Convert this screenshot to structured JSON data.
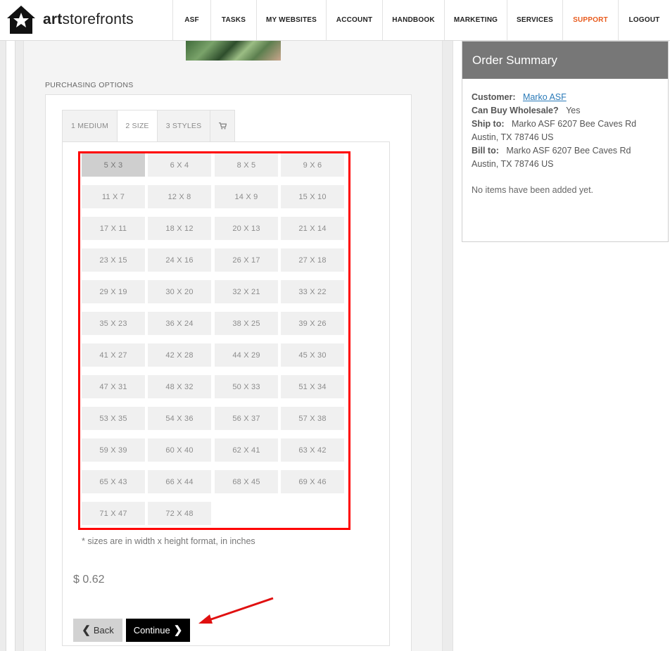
{
  "brand": {
    "name_bold": "art",
    "name_rest": "storefronts"
  },
  "nav": [
    {
      "label": "ASF",
      "width": 54
    },
    {
      "label": "TASKS",
      "width": 65
    },
    {
      "label": "MY WEBSITES",
      "width": 99
    },
    {
      "label": "ACCOUNT",
      "width": 80
    },
    {
      "label": "HANDBOOK",
      "width": 88
    },
    {
      "label": "MARKETING",
      "width": 89
    },
    {
      "label": "SERVICES",
      "width": 79
    },
    {
      "label": "SUPPORT",
      "width": 79,
      "active": true
    },
    {
      "label": "LOGOUT",
      "width": 74
    }
  ],
  "purchasing": {
    "section_label": "PURCHASING OPTIONS",
    "tabs": [
      {
        "label": "1 MEDIUM"
      },
      {
        "label": "2 SIZE",
        "active": true
      },
      {
        "label": "3 STYLES"
      },
      {
        "icon": "cart-icon"
      }
    ],
    "sizes": [
      "5 X 3",
      "6 X 4",
      "8 X 5",
      "9 X 6",
      "11 X 7",
      "12 X 8",
      "14 X 9",
      "15 X 10",
      "17 X 11",
      "18 X 12",
      "20 X 13",
      "21 X 14",
      "23 X 15",
      "24 X 16",
      "26 X 17",
      "27 X 18",
      "29 X 19",
      "30 X 20",
      "32 X 21",
      "33 X 22",
      "35 X 23",
      "36 X 24",
      "38 X 25",
      "39 X 26",
      "41 X 27",
      "42 X 28",
      "44 X 29",
      "45 X 30",
      "47 X 31",
      "48 X 32",
      "50 X 33",
      "51 X 34",
      "53 X 35",
      "54 X 36",
      "56 X 37",
      "57 X 38",
      "59 X 39",
      "60 X 40",
      "62 X 41",
      "63 X 42",
      "65 X 43",
      "66 X 44",
      "68 X 45",
      "69 X 46",
      "71 X 47",
      "72 X 48"
    ],
    "selected_size": "5 X 3",
    "note": "* sizes are in width x height format, in inches",
    "price": "$ 0.62",
    "back_label": "Back",
    "continue_label": "Continue"
  },
  "summary": {
    "title": "Order Summary",
    "customer_label": "Customer:",
    "customer_value": "Marko ASF",
    "wholesale_label": "Can Buy Wholesale?",
    "wholesale_value": "Yes",
    "ship_label": "Ship to:",
    "ship_value": "Marko ASF 6207 Bee Caves Rd Austin, TX 78746 US",
    "bill_label": "Bill to:",
    "bill_value": "Marko ASF 6207 Bee Caves Rd Austin, TX 78746 US",
    "empty_message": "No items have been added yet."
  },
  "colors": {
    "accent": "#e85a1c",
    "highlight_border": "#ff0000",
    "summary_header": "#777777"
  }
}
